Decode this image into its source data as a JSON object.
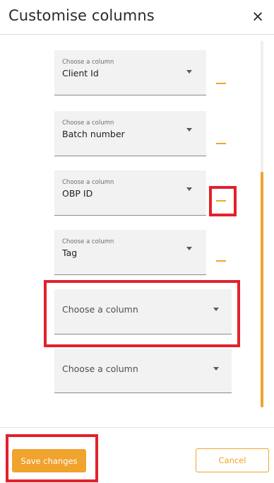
{
  "header": {
    "title": "Customise columns",
    "close_label": "×"
  },
  "columns": [
    {
      "small_label": "Choose a column",
      "value": "Client Id",
      "remove_icon": "minus-icon"
    },
    {
      "small_label": "Choose a column",
      "value": "Batch number",
      "remove_icon": "minus-icon"
    },
    {
      "small_label": "Choose a column",
      "value": "OBP ID",
      "remove_icon": "minus-icon"
    },
    {
      "small_label": "Choose a column",
      "value": "Tag",
      "remove_icon": "minus-icon"
    },
    {
      "placeholder": "Choose a column"
    },
    {
      "placeholder": "Choose a column"
    }
  ],
  "footer": {
    "save_label": "Save changes",
    "cancel_label": "Cancel"
  },
  "colors": {
    "accent": "#f0a32d",
    "highlight": "#e3202b",
    "field_bg": "#f2f2f2"
  }
}
